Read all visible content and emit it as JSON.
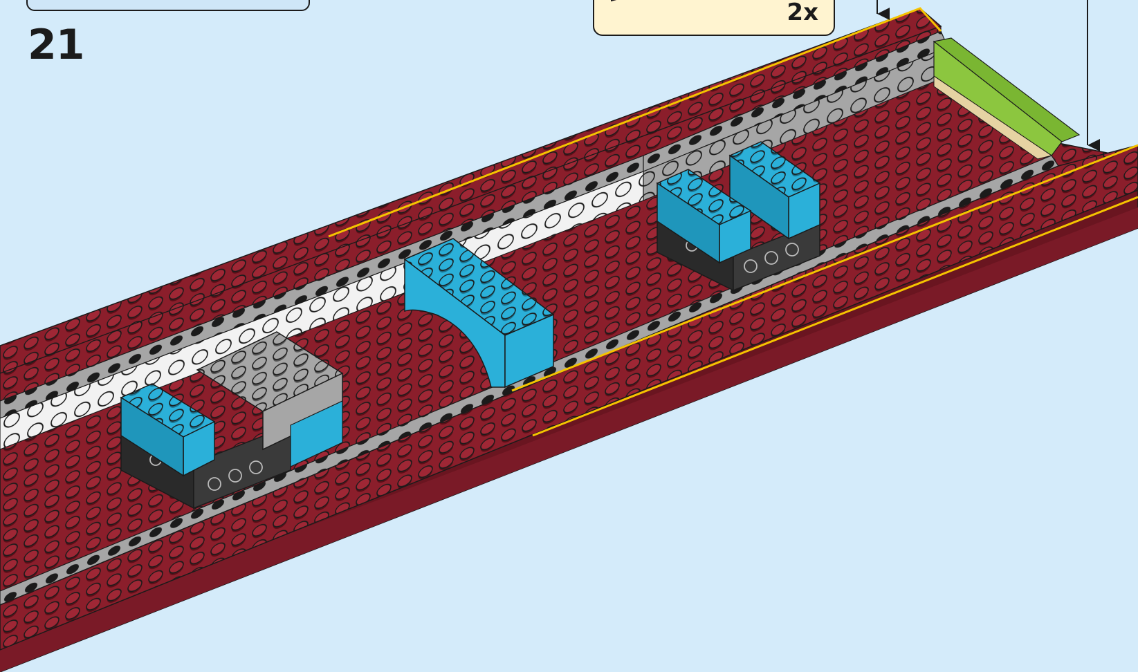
{
  "instruction_page": {
    "step_number": "21",
    "parts_callout": {
      "quantity": "2x",
      "part_color": "#8b1e2b"
    },
    "colors": {
      "background": "#d4ebfa",
      "dark_red": "#8b1e2b",
      "dark_red_shadow": "#6a1520",
      "azure": "#2bb0d9",
      "light_gray": "#a6a6a6",
      "white": "#f2f2f2",
      "lime": "#8cc63f",
      "black": "#1b1b1b",
      "highlight": "#f5c400"
    },
    "icons": [
      "down-arrow-icon",
      "down-arrow-icon"
    ]
  }
}
